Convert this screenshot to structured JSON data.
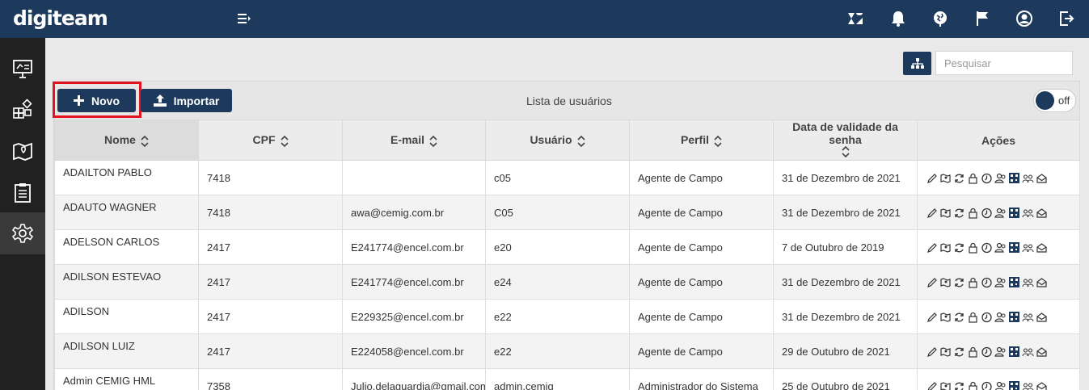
{
  "app": {
    "logo": "digiteam",
    "top_icons": [
      "zendesk-icon",
      "bell-icon",
      "globe-icon",
      "flag-icon",
      "user-circle-icon",
      "logout-icon"
    ]
  },
  "sidebar": {
    "items": [
      "presentation-icon",
      "modules-icon",
      "map-icon",
      "clipboard-icon",
      "gear-icon"
    ],
    "active": "gear-icon"
  },
  "search": {
    "placeholder": "Pesquisar",
    "value": ""
  },
  "toolbar": {
    "novo_label": "Novo",
    "importar_label": "Importar",
    "list_title": "Lista de usuários",
    "toggle_label": "off"
  },
  "table": {
    "columns": [
      "Nome",
      "CPF",
      "E-mail",
      "Usuário",
      "Perfil",
      "Data de validade da senha",
      "Ações"
    ],
    "rows": [
      {
        "nome": "ADAILTON PABLO",
        "cpf": "7418",
        "email": "",
        "usuario": "c05",
        "perfil": "Agente de Campo",
        "validade": "31 de Dezembro de 2021"
      },
      {
        "nome": "ADAUTO WAGNER",
        "cpf": "7418",
        "email": "awa@cemig.com.br",
        "usuario": "C05",
        "perfil": "Agente de Campo",
        "validade": "31 de Dezembro de 2021"
      },
      {
        "nome": "ADELSON CARLOS",
        "cpf": "2417",
        "email": "E241774@encel.com.br",
        "usuario": "e20",
        "perfil": "Agente de Campo",
        "validade": "7 de Outubro de 2019"
      },
      {
        "nome": "ADILSON ESTEVAO",
        "cpf": "2417",
        "email": "E241774@encel.com.br",
        "usuario": "e24",
        "perfil": "Agente de Campo",
        "validade": "31 de Dezembro de 2021"
      },
      {
        "nome": "ADILSON",
        "cpf": "2417",
        "email": "E229325@encel.com.br",
        "usuario": "e22",
        "perfil": "Agente de Campo",
        "validade": "31 de Dezembro de 2021"
      },
      {
        "nome": "ADILSON LUIZ",
        "cpf": "2417",
        "email": "E224058@encel.com.br",
        "usuario": "e22",
        "perfil": "Agente de Campo",
        "validade": "29 de Outubro de 2021"
      },
      {
        "nome": "Admin CEMIG HML",
        "cpf": "7358",
        "email": "Julio.delaguardia@gmail.com",
        "usuario": "admin.cemig",
        "perfil": "Administrador do Sistema",
        "validade": "25 de Outubro de 2021"
      }
    ],
    "row_actions": [
      "edit-icon",
      "map-icon",
      "refresh-icon",
      "lock-icon",
      "clock-icon",
      "users-icon",
      "qr-code-icon",
      "group-icon",
      "mail-icon"
    ]
  },
  "colors": {
    "primary": "#1d3a5c",
    "highlight": "#e0141f",
    "sidebar": "#212121"
  }
}
